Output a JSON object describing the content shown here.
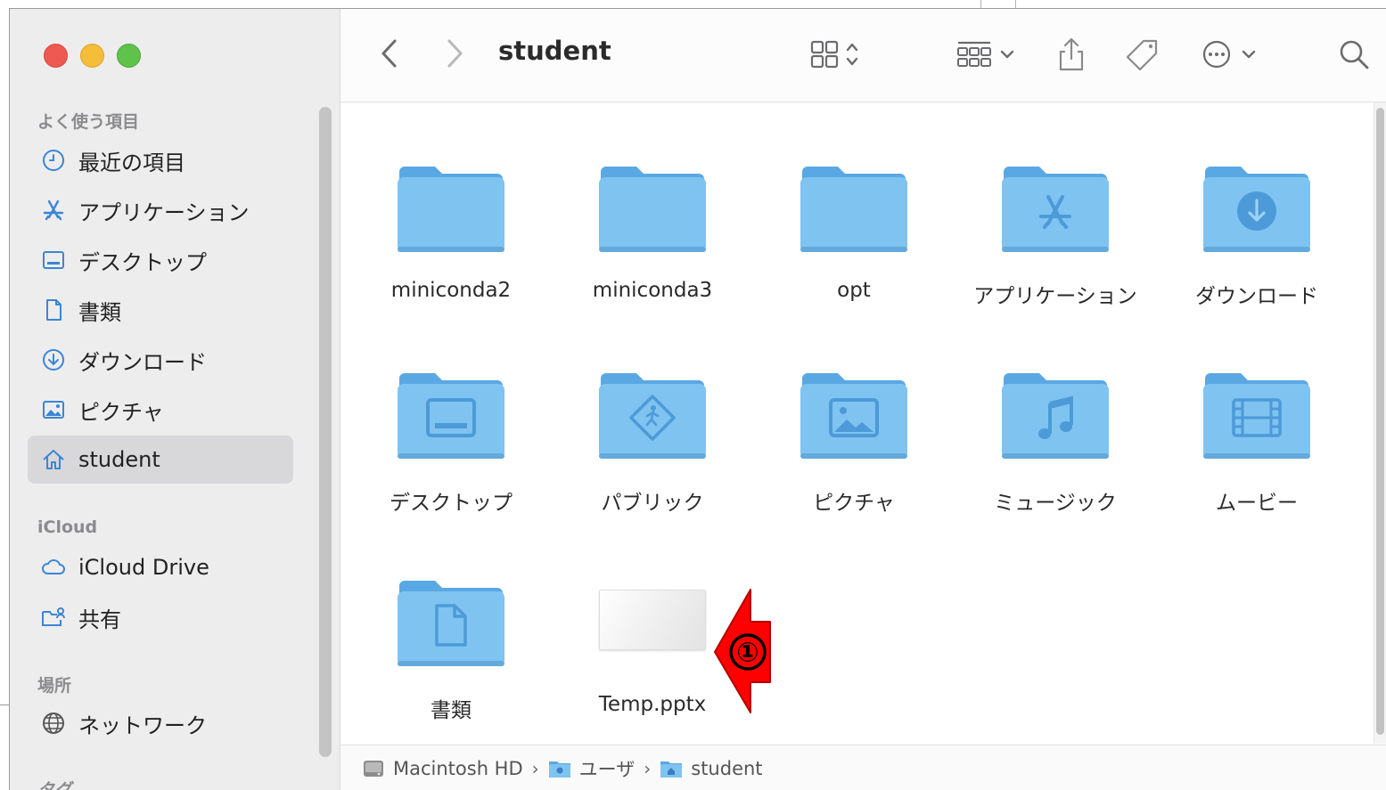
{
  "window": {
    "title": "student"
  },
  "sidebar": {
    "favorites_heading": "よく使う項目",
    "favorites": [
      {
        "label": "最近の項目",
        "icon": "clock-icon"
      },
      {
        "label": "アプリケーション",
        "icon": "applications-icon"
      },
      {
        "label": "デスクトップ",
        "icon": "desktop-icon"
      },
      {
        "label": "書類",
        "icon": "document-icon"
      },
      {
        "label": "ダウンロード",
        "icon": "download-icon"
      },
      {
        "label": "ピクチャ",
        "icon": "pictures-icon"
      },
      {
        "label": "student",
        "icon": "home-icon",
        "selected": true
      }
    ],
    "icloud_heading": "iCloud",
    "icloud": [
      {
        "label": "iCloud Drive",
        "icon": "cloud-icon"
      },
      {
        "label": "共有",
        "icon": "shared-folder-icon"
      }
    ],
    "locations_heading": "場所",
    "locations": [
      {
        "label": "ネットワーク",
        "icon": "network-icon"
      }
    ],
    "tags_heading": "タグ"
  },
  "items": [
    {
      "label": "miniconda2",
      "kind": "folder",
      "glyph": "none"
    },
    {
      "label": "miniconda3",
      "kind": "folder",
      "glyph": "none"
    },
    {
      "label": "opt",
      "kind": "folder",
      "glyph": "none"
    },
    {
      "label": "アプリケーション",
      "kind": "folder",
      "glyph": "app"
    },
    {
      "label": "ダウンロード",
      "kind": "folder",
      "glyph": "download"
    },
    {
      "label": "デスクトップ",
      "kind": "folder",
      "glyph": "desktop"
    },
    {
      "label": "パブリック",
      "kind": "folder",
      "glyph": "public"
    },
    {
      "label": "ピクチャ",
      "kind": "folder",
      "glyph": "pictures"
    },
    {
      "label": "ミュージック",
      "kind": "folder",
      "glyph": "music"
    },
    {
      "label": "ムービー",
      "kind": "folder",
      "glyph": "movie"
    },
    {
      "label": "書類",
      "kind": "folder",
      "glyph": "document"
    },
    {
      "label": "Temp.pptx",
      "kind": "pptx",
      "glyph": "none"
    }
  ],
  "pathbar": [
    {
      "label": "Macintosh HD",
      "icon": "hard-drive-icon"
    },
    {
      "label": "ユーザ",
      "icon": "users-folder-icon"
    },
    {
      "label": "student",
      "icon": "home-folder-icon"
    }
  ],
  "pathbar_separator": "›",
  "annotation": {
    "label": "①",
    "color": "#ff0000"
  },
  "colors": {
    "folder": "#7fc3f1",
    "folder_tab": "#5aa8e3",
    "glyph": "#4d9ad8",
    "accent_red": "#ff0000"
  }
}
